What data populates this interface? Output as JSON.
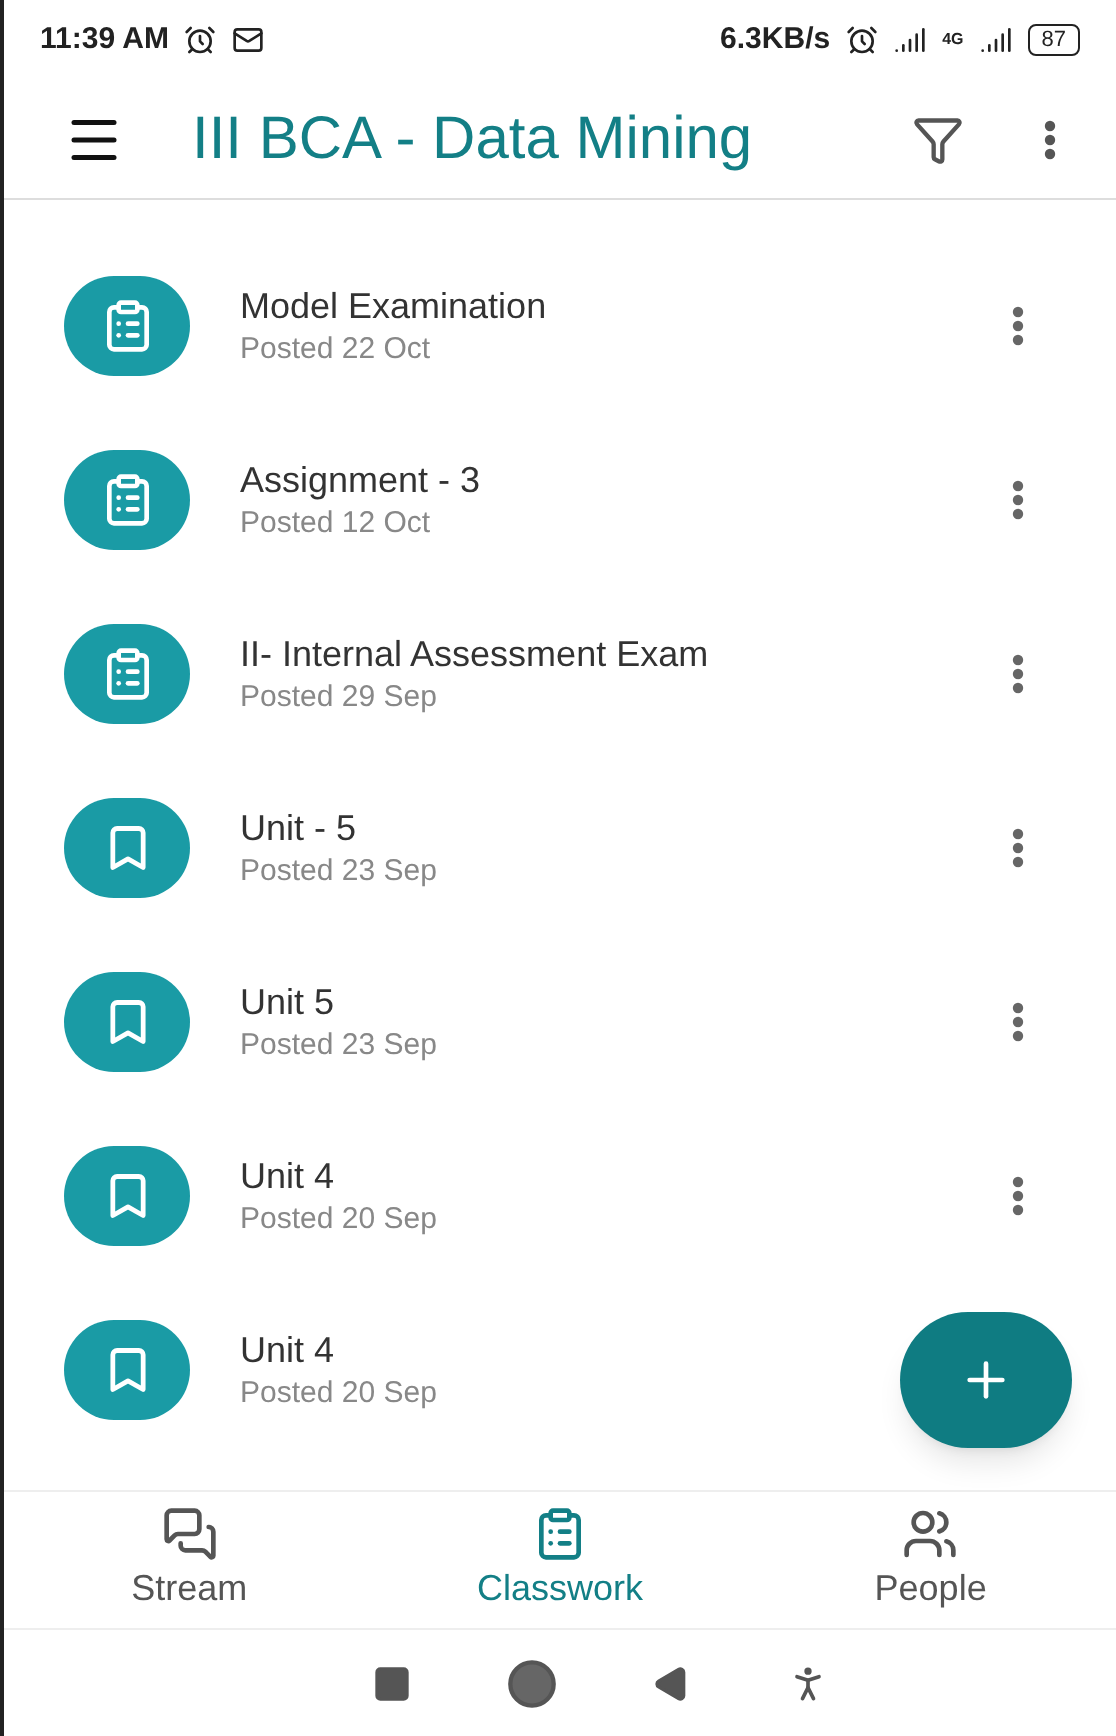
{
  "status_bar": {
    "time": "11:39 AM",
    "speed": "6.3KB/s",
    "network": "4G",
    "battery": "87"
  },
  "app_bar": {
    "title": "III BCA - Data Mining"
  },
  "items": [
    {
      "kind": "assignment",
      "title": "Model Examination",
      "posted": "Posted 22 Oct"
    },
    {
      "kind": "assignment",
      "title": "Assignment - 3",
      "posted": "Posted 12 Oct"
    },
    {
      "kind": "assignment",
      "title": "II- Internal Assessment Exam",
      "posted": "Posted 29 Sep"
    },
    {
      "kind": "material",
      "title": "Unit - 5",
      "posted": "Posted 23 Sep"
    },
    {
      "kind": "material",
      "title": "Unit 5",
      "posted": "Posted 23 Sep"
    },
    {
      "kind": "material",
      "title": "Unit 4",
      "posted": "Posted 20 Sep"
    },
    {
      "kind": "material",
      "title": "Unit 4",
      "posted": "Posted 20 Sep"
    }
  ],
  "tabs": [
    {
      "kind": "stream",
      "label": "Stream",
      "selected": false
    },
    {
      "kind": "classwork",
      "label": "Classwork",
      "selected": true
    },
    {
      "kind": "people",
      "label": "People",
      "selected": false
    }
  ]
}
